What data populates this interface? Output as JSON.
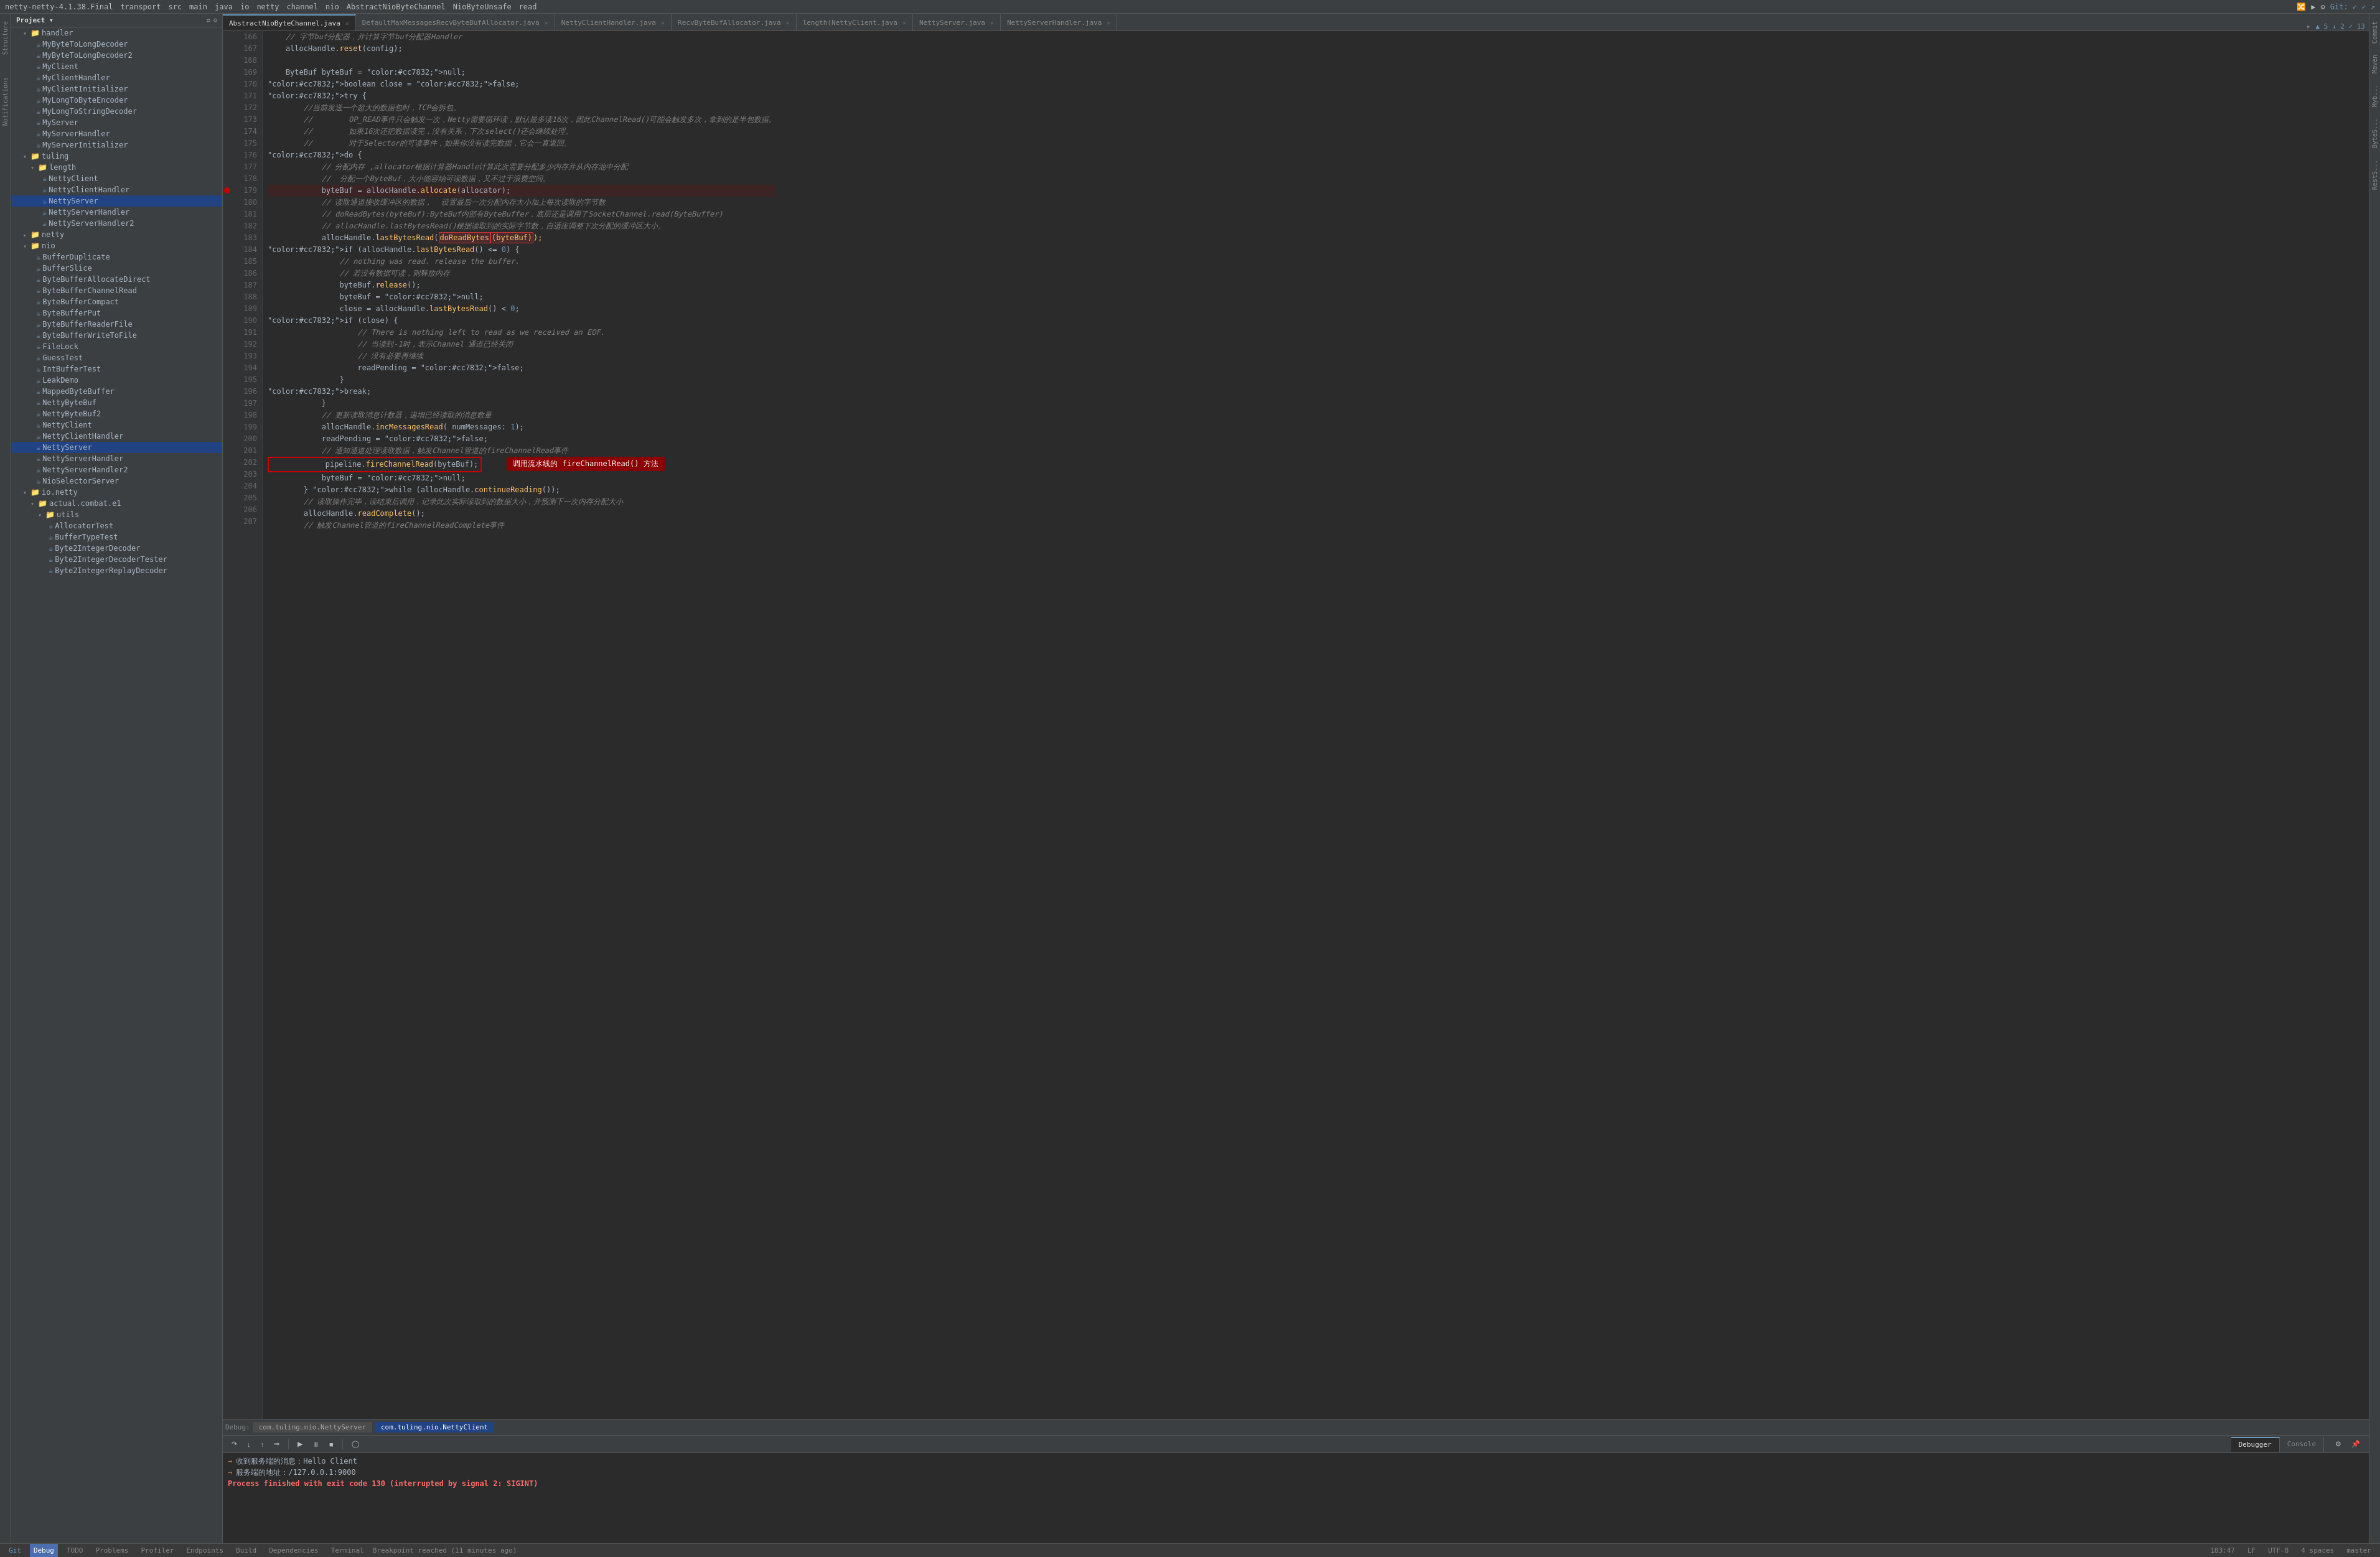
{
  "window": {
    "title": "netty-netty-4.1.38.Final",
    "menu_items": [
      "netty-netty-4.1.38.Final",
      "transport",
      "src",
      "main",
      "java",
      "io",
      "netty",
      "channel",
      "nio",
      "AbstractNioByteChannel",
      "NioByteUnsafe",
      "read"
    ]
  },
  "toolbar": {
    "project_label": "Project",
    "icons": [
      "layout",
      "sync",
      "settings"
    ]
  },
  "tabs": [
    {
      "id": "tab1",
      "label": "AbstractNioByteChannel.java",
      "active": true,
      "modified": false
    },
    {
      "id": "tab2",
      "label": "DefaultMaxMessagesRecvByteBufAllocator.java",
      "active": false
    },
    {
      "id": "tab3",
      "label": "NettyClientHandler.java",
      "active": false
    },
    {
      "id": "tab4",
      "label": "RecvByteBufAllocator.java",
      "active": false
    },
    {
      "id": "tab5",
      "label": "length(NettyClient.java",
      "active": false
    },
    {
      "id": "tab6",
      "label": "NettyServer.java",
      "active": false
    },
    {
      "id": "tab7",
      "label": "NettyServerHandler.java",
      "active": false
    }
  ],
  "sidebar": {
    "title": "Project",
    "tree": [
      {
        "level": 1,
        "type": "folder",
        "label": "handler",
        "expanded": true
      },
      {
        "level": 2,
        "type": "file",
        "label": "MyByteToLongDecoder"
      },
      {
        "level": 2,
        "type": "file",
        "label": "MyByteToLongDecoder2"
      },
      {
        "level": 2,
        "type": "file",
        "label": "MyClient"
      },
      {
        "level": 2,
        "type": "file",
        "label": "MyClientHandler"
      },
      {
        "level": 2,
        "type": "file",
        "label": "MyClientInitializer"
      },
      {
        "level": 2,
        "type": "file",
        "label": "MyLongToByteEncoder"
      },
      {
        "level": 2,
        "type": "file",
        "label": "MyLongToStringDecoder"
      },
      {
        "level": 2,
        "type": "file",
        "label": "MyServer"
      },
      {
        "level": 2,
        "type": "file",
        "label": "MyServerHandler"
      },
      {
        "level": 2,
        "type": "file",
        "label": "MyServerInitializer"
      },
      {
        "level": 1,
        "type": "folder",
        "label": "tuling",
        "expanded": true
      },
      {
        "level": 2,
        "type": "folder",
        "label": "length",
        "expanded": true
      },
      {
        "level": 3,
        "type": "file",
        "label": "NettyClient",
        "highlighted": false
      },
      {
        "level": 3,
        "type": "file",
        "label": "NettyClientHandler"
      },
      {
        "level": 3,
        "type": "file",
        "label": "NettyServer",
        "selected": true
      },
      {
        "level": 3,
        "type": "file",
        "label": "NettyServerHandler"
      },
      {
        "level": 3,
        "type": "file",
        "label": "NettyServerHandler2"
      },
      {
        "level": 1,
        "type": "folder",
        "label": "netty",
        "expanded": false
      },
      {
        "level": 1,
        "type": "folder",
        "label": "nio",
        "expanded": true
      },
      {
        "level": 2,
        "type": "file",
        "label": "BufferDuplicate"
      },
      {
        "level": 2,
        "type": "file",
        "label": "BufferSlice"
      },
      {
        "level": 2,
        "type": "file",
        "label": "ByteBufferAllocateDirect"
      },
      {
        "level": 2,
        "type": "file",
        "label": "ByteBufferChannelRead"
      },
      {
        "level": 2,
        "type": "file",
        "label": "ByteBufferCompact"
      },
      {
        "level": 2,
        "type": "file",
        "label": "ByteBufferPut"
      },
      {
        "level": 2,
        "type": "file",
        "label": "ByteBufferReaderFile"
      },
      {
        "level": 2,
        "type": "file",
        "label": "ByteBufferWriteToFile"
      },
      {
        "level": 2,
        "type": "file",
        "label": "FileLock"
      },
      {
        "level": 2,
        "type": "file",
        "label": "GuessTest"
      },
      {
        "level": 2,
        "type": "file",
        "label": "IntBufferTest"
      },
      {
        "level": 2,
        "type": "file",
        "label": "LeakDemo"
      },
      {
        "level": 2,
        "type": "file",
        "label": "MappedByteBuffer"
      },
      {
        "level": 2,
        "type": "file",
        "label": "NettyByteBuf"
      },
      {
        "level": 2,
        "type": "file",
        "label": "NettyByteBuf2"
      },
      {
        "level": 2,
        "type": "file",
        "label": "NettyClient"
      },
      {
        "level": 2,
        "type": "file",
        "label": "NettyClientHandler"
      },
      {
        "level": 2,
        "type": "file",
        "label": "NettyServer",
        "selected": true
      },
      {
        "level": 2,
        "type": "file",
        "label": "NettyServerHandler"
      },
      {
        "level": 2,
        "type": "file",
        "label": "NettyServerHandler2"
      },
      {
        "level": 2,
        "type": "file",
        "label": "NioSelectorServer"
      },
      {
        "level": 1,
        "type": "folder",
        "label": "io.netty",
        "expanded": true
      },
      {
        "level": 2,
        "type": "folder",
        "label": "actual.combat.e1",
        "expanded": true
      },
      {
        "level": 3,
        "type": "folder",
        "label": "utils",
        "expanded": true
      },
      {
        "level": 4,
        "type": "file",
        "label": "AllocatorTest"
      },
      {
        "level": 4,
        "type": "file",
        "label": "BufferTypeTest"
      },
      {
        "level": 4,
        "type": "file",
        "label": "Byte2IntegerDecoder"
      },
      {
        "level": 4,
        "type": "file",
        "label": "Byte2IntegerDecoderTester"
      },
      {
        "level": 4,
        "type": "file",
        "label": "Byte2IntegerReplayDecoder"
      }
    ]
  },
  "code": {
    "filename": "AbstractNioByteChannel.java",
    "lines": [
      {
        "num": 166,
        "content": "    // 字节buf分配器，并计算字节buf分配器Handler",
        "type": "comment"
      },
      {
        "num": 167,
        "content": "    allocHandle.reset(config);",
        "type": "code"
      },
      {
        "num": 168,
        "content": "",
        "type": "empty"
      },
      {
        "num": 169,
        "content": "    ByteBuf byteBuf = null;",
        "type": "code"
      },
      {
        "num": 170,
        "content": "    boolean close = false;",
        "type": "code"
      },
      {
        "num": 171,
        "content": "    try {",
        "type": "code"
      },
      {
        "num": 172,
        "content": "        //当前发送一个超大的数据包时，TCP会拆包。",
        "type": "comment"
      },
      {
        "num": 173,
        "content": "        //        OP_READ事件只会触发一次，Netty需要循环读，默认最多读16次，因此ChannelRead()可能会触发多次，拿到的是半包数据。",
        "type": "comment"
      },
      {
        "num": 174,
        "content": "        //        如果16次还把数据读完，没有关系，下次select()还会继续处理。",
        "type": "comment"
      },
      {
        "num": 175,
        "content": "        //        对于Selector的可读事件，如果你没有读完数据，它会一直返回。",
        "type": "comment"
      },
      {
        "num": 176,
        "content": "        do {",
        "type": "code"
      },
      {
        "num": 177,
        "content": "            // 分配内存 ,allocator根据计算器Handle计算此次需要分配多少内存并从内存池中分配",
        "type": "comment"
      },
      {
        "num": 178,
        "content": "            //  分配一个ByteBuf，大小能容纳可读数据，又不过于浪费空间。",
        "type": "comment"
      },
      {
        "num": 179,
        "content": "            byteBuf = allocHandle.allocate(allocator);",
        "type": "code",
        "breakpoint": true
      },
      {
        "num": 180,
        "content": "            // 读取通道接收缓冲区的数据，  设置最后一次分配内存大小加上每次读取的字节数",
        "type": "comment"
      },
      {
        "num": 181,
        "content": "            // doReadBytes(byteBuf):ByteBuf内部有ByteBuffer，底层还是调用了SocketChannel.read(ByteBuffer)",
        "type": "comment"
      },
      {
        "num": 182,
        "content": "            // allocHandle.lastBytesRead()根据读取到的实际字节数，自适应调整下次分配的缓冲区大小。",
        "type": "comment"
      },
      {
        "num": 183,
        "content": "            allocHandle.lastBytesRead(doReadBytes(byteBuf));",
        "type": "code",
        "highlighted": true
      },
      {
        "num": 184,
        "content": "            if (allocHandle.lastBytesRead() <= 0) {",
        "type": "code"
      },
      {
        "num": 185,
        "content": "                // nothing was read. release the buffer.",
        "type": "comment"
      },
      {
        "num": 186,
        "content": "                // 若没有数据可读，则释放内存",
        "type": "comment"
      },
      {
        "num": 187,
        "content": "                byteBuf.release();",
        "type": "code"
      },
      {
        "num": 188,
        "content": "                byteBuf = null;",
        "type": "code"
      },
      {
        "num": 189,
        "content": "                close = allocHandle.lastBytesRead() < 0;",
        "type": "code"
      },
      {
        "num": 190,
        "content": "                if (close) {",
        "type": "code"
      },
      {
        "num": 191,
        "content": "                    // There is nothing left to read as we received an EOF.",
        "type": "comment"
      },
      {
        "num": 192,
        "content": "                    // 当读到-1时，表示Channel 通道已经关闭",
        "type": "comment"
      },
      {
        "num": 193,
        "content": "                    // 没有必要再继续",
        "type": "comment"
      },
      {
        "num": 194,
        "content": "                    readPending = false;",
        "type": "code"
      },
      {
        "num": 195,
        "content": "                }",
        "type": "code"
      },
      {
        "num": 196,
        "content": "                break;",
        "type": "code"
      },
      {
        "num": 197,
        "content": "            }",
        "type": "code"
      },
      {
        "num": 198,
        "content": "            // 更新读取消息计数器，递增已经读取的消息数量",
        "type": "comment"
      },
      {
        "num": 199,
        "content": "            allocHandle.incMessagesRead( numMessages: 1);",
        "type": "code"
      },
      {
        "num": 200,
        "content": "            readPending = false;",
        "type": "code"
      },
      {
        "num": 201,
        "content": "            // 通知通道处理读取数据，触发Channel管道的fireChannelRead事件",
        "type": "comment"
      },
      {
        "num": 202,
        "content": "            pipeline.fireChannelRead(byteBuf);",
        "type": "code",
        "annotation": "调用流水线的 fireChannelRead() 方法",
        "annotated_box": true
      },
      {
        "num": 203,
        "content": "            byteBuf = null;",
        "type": "code"
      },
      {
        "num": 204,
        "content": "        } while (allocHandle.continueReading());",
        "type": "code"
      },
      {
        "num": 205,
        "content": "        // 读取操作完毕，读结束后调用，记录此次实际读取到的数据大小，并预测下一次内存分配大小",
        "type": "comment"
      },
      {
        "num": 206,
        "content": "        allocHandle.readComplete();",
        "type": "code"
      },
      {
        "num": 207,
        "content": "        // 触发Channel管道的fireChannelReadComplete事件",
        "type": "comment"
      }
    ]
  },
  "bottom_panel": {
    "tabs": [
      "Debugger",
      "Console"
    ],
    "active_tab": "Console",
    "debug_sessions": [
      {
        "label": "com.tuling.nio.NettyServer",
        "active": false
      },
      {
        "label": "com.tuling.nio.NettyClient",
        "active": true
      }
    ],
    "console_lines": [
      {
        "type": "info",
        "text": "收到服务端的消息：Hello Client"
      },
      {
        "type": "info",
        "text": "服务端的地址：/127.0.0.1:9000"
      },
      {
        "type": "error",
        "text": "Process finished with exit code 130 (interrupted by signal 2: SIGINT)"
      }
    ]
  },
  "status_bar": {
    "git": "Git",
    "debug": "Debug",
    "todo": "TODO",
    "problems": "Problems",
    "profiler": "Profiler",
    "endpoints": "Endpoints",
    "build": "Build",
    "dependencies": "Dependencies",
    "terminal": "Terminal",
    "breakpoint_msg": "Breakpoint reached (11 minutes ago)",
    "position": "183:47",
    "encoding": "UTF-8",
    "indent": "4 spaces",
    "lf": "LF",
    "branch": "master"
  },
  "right_panels": [
    "Commit",
    "Maven",
    "Myb...",
    "ByteS..."
  ],
  "left_panels": [
    "Structure",
    "Notifications"
  ]
}
